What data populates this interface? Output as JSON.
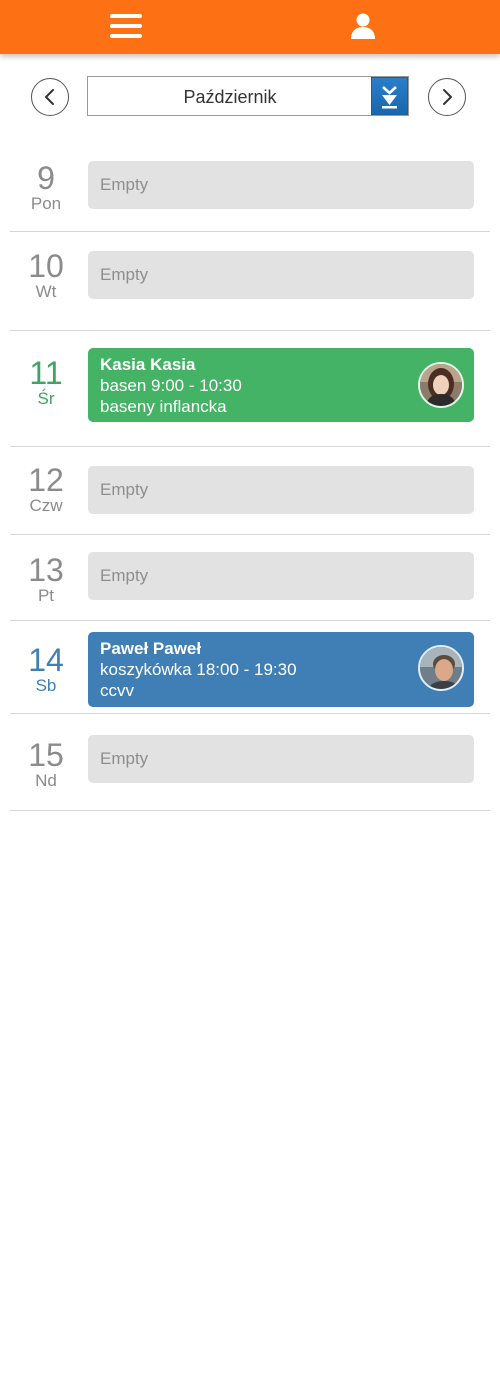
{
  "header": {
    "menu_icon": "hamburger-menu-icon",
    "user_icon": "user-profile-icon",
    "background": "#fe7014"
  },
  "month_nav": {
    "prev_icon": "chevron-left-icon",
    "next_icon": "chevron-right-icon",
    "selected_month": "Październik",
    "dropdown_icon": "double-chevron-down-icon"
  },
  "days": [
    {
      "number": "9",
      "name": "Pon",
      "slot": {
        "type": "empty",
        "label": "Empty"
      }
    },
    {
      "number": "10",
      "name": "Wt",
      "slot": {
        "type": "empty",
        "label": "Empty"
      }
    },
    {
      "number": "11",
      "name": "Śr",
      "slot": {
        "type": "event",
        "person": "Kasia Kasia",
        "activity": "basen 9:00 - 10:30",
        "location": "baseny inflancka",
        "color": "#45b365"
      }
    },
    {
      "number": "12",
      "name": "Czw",
      "slot": {
        "type": "empty",
        "label": "Empty"
      }
    },
    {
      "number": "13",
      "name": "Pt",
      "slot": {
        "type": "empty",
        "label": "Empty"
      }
    },
    {
      "number": "14",
      "name": "Sb",
      "slot": {
        "type": "event",
        "person": "Paweł Paweł",
        "activity": "koszykówka 18:00 - 19:30",
        "location": "ccvv",
        "color": "#3f7fb6"
      }
    },
    {
      "number": "15",
      "name": "Nd",
      "slot": {
        "type": "empty",
        "label": "Empty"
      }
    }
  ]
}
